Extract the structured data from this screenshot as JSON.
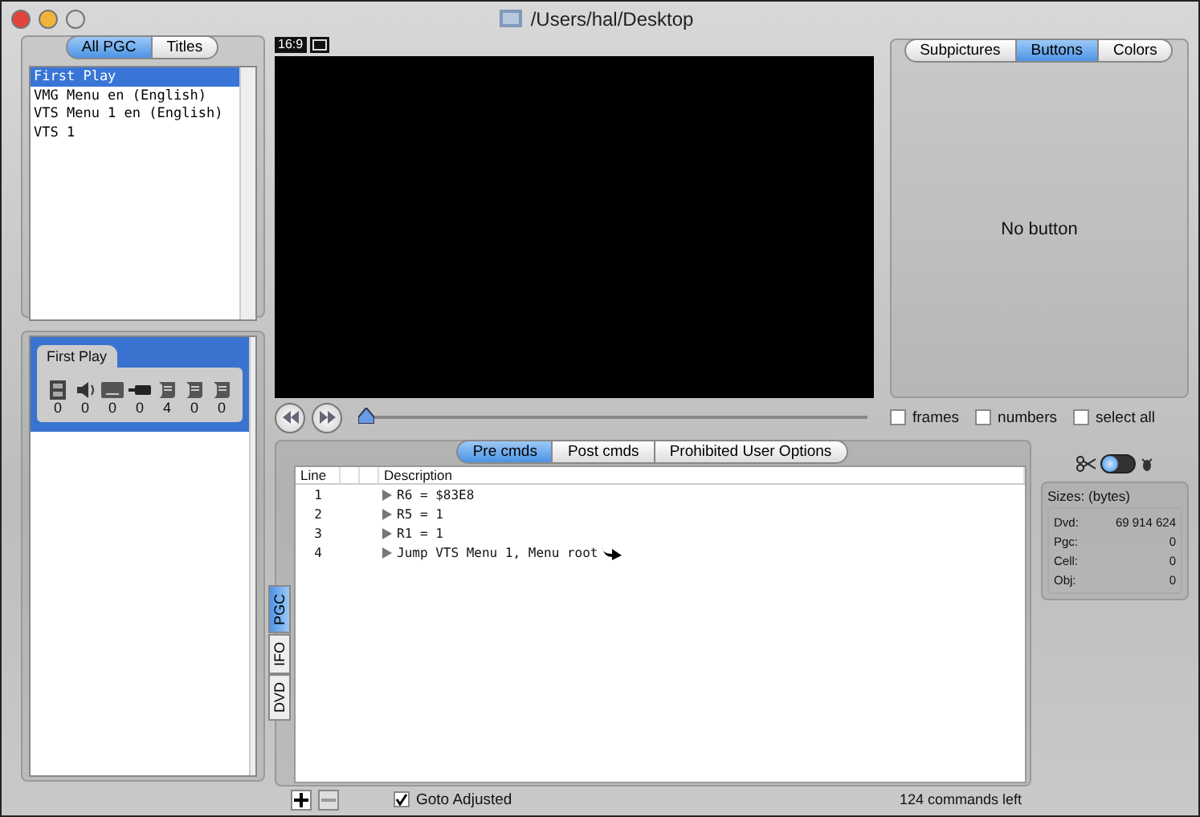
{
  "window": {
    "title": "/Users/hal/Desktop"
  },
  "pgc_tabs": [
    {
      "label": "All PGC",
      "selected": true
    },
    {
      "label": "Titles",
      "selected": false
    }
  ],
  "pgc_list": [
    {
      "label": "First Play",
      "selected": true
    },
    {
      "label": "VMG Menu en (English)",
      "selected": false
    },
    {
      "label": "VTS Menu 1 en (English)",
      "selected": false
    },
    {
      "label": "VTS 1",
      "selected": false
    }
  ],
  "detail_card": {
    "title": "First Play",
    "streams": [
      {
        "kind": "video",
        "count": "0"
      },
      {
        "kind": "audio",
        "count": "0"
      },
      {
        "kind": "subtitle",
        "count": "0"
      },
      {
        "kind": "cable",
        "count": "0"
      },
      {
        "kind": "script",
        "count": "4"
      },
      {
        "kind": "script",
        "count": "0"
      },
      {
        "kind": "script",
        "count": "0"
      }
    ]
  },
  "preview": {
    "aspect": "16:9",
    "position": {
      "level": 0
    }
  },
  "subpicture_tabs": [
    {
      "label": "Subpictures",
      "selected": false
    },
    {
      "label": "Buttons",
      "selected": true
    },
    {
      "label": "Colors",
      "selected": false
    }
  ],
  "subpicture_message": "No button",
  "options": [
    {
      "label": "frames",
      "checked": false
    },
    {
      "label": "numbers",
      "checked": false
    },
    {
      "label": "select all",
      "checked": false
    }
  ],
  "command_tabs": [
    {
      "label": "Pre cmds",
      "selected": true
    },
    {
      "label": "Post cmds",
      "selected": false
    },
    {
      "label": "Prohibited User Options",
      "selected": false
    }
  ],
  "side_tabs": [
    {
      "label": "PGC",
      "selected": true
    },
    {
      "label": "IFO",
      "selected": false
    },
    {
      "label": "DVD",
      "selected": false
    }
  ],
  "table": {
    "columns": [
      "Line",
      "Description"
    ],
    "rows": [
      {
        "line": "1",
        "description": "R6 = $83E8",
        "kind": "set"
      },
      {
        "line": "2",
        "description": "R5 = 1",
        "kind": "set"
      },
      {
        "line": "3",
        "description": "R1 = 1",
        "kind": "set"
      },
      {
        "line": "4",
        "description": "Jump VTS Menu 1, Menu root",
        "kind": "jump"
      }
    ]
  },
  "mode_switch": {
    "on": false
  },
  "sizes": {
    "title": "Sizes: (bytes)",
    "rows": [
      {
        "label": "Dvd:",
        "value": "69 914 624"
      },
      {
        "label": "Pgc:",
        "value": "0"
      },
      {
        "label": "Cell:",
        "value": "0"
      },
      {
        "label": "Obj:",
        "value": "0"
      }
    ]
  },
  "footer": {
    "goto": {
      "label": "Goto Adjusted",
      "checked": true
    },
    "status": "124 commands left"
  }
}
